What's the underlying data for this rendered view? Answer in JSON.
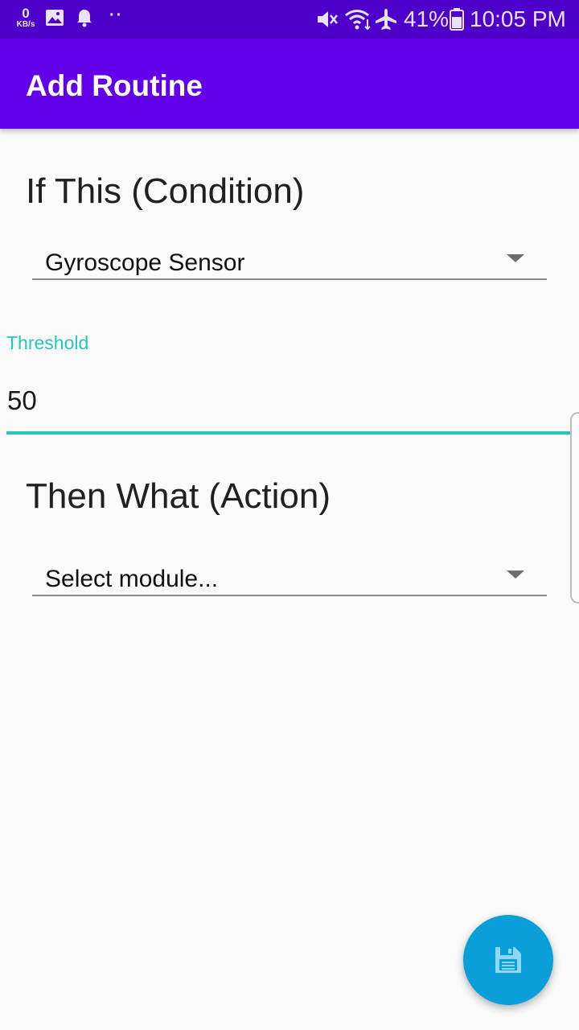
{
  "status_bar": {
    "data_rate": "0",
    "data_rate_unit": "KB/s",
    "icons": [
      "image-icon",
      "notification-bell-icon",
      "more-dots-icon",
      "mute-vibrate-icon",
      "wifi-icon",
      "airplane-mode-icon",
      "battery-icon"
    ],
    "more_dots": "··",
    "battery_percent": "41%",
    "time": "10:05 PM"
  },
  "app_bar": {
    "title": "Add Routine",
    "background": "#6200ea"
  },
  "condition": {
    "heading": "If This (Condition)",
    "sensor_selected": "Gyroscope Sensor"
  },
  "threshold": {
    "label": "Threshold",
    "value": "50",
    "accent": "#26c6bd"
  },
  "action": {
    "heading": "Then What (Action)",
    "module_selected": "Select module..."
  },
  "fab": {
    "icon": "save-icon",
    "color": "#0a9fd8"
  }
}
